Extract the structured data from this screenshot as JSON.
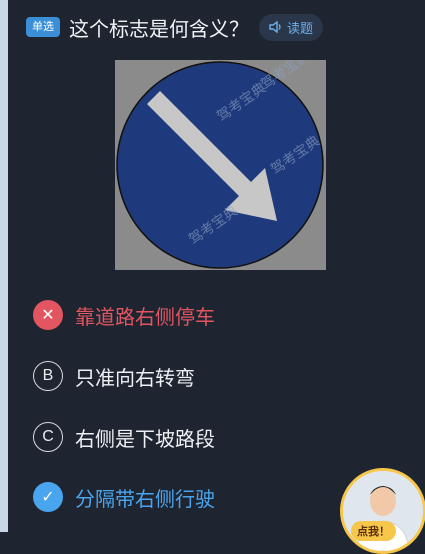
{
  "question": {
    "tag": "单选",
    "text": "这个标志是何含义？",
    "read_button": "读题"
  },
  "sign": {
    "watermark": "驾考宝典",
    "colors": {
      "disk": "#1f3a7c",
      "arrow": "#c7c7c7",
      "background": "#8b8b8b"
    }
  },
  "options": [
    {
      "marker": "✕",
      "text": "靠道路右侧停车",
      "state": "wrong"
    },
    {
      "marker": "B",
      "text": "只准向右转弯",
      "state": "plain"
    },
    {
      "marker": "C",
      "text": "右侧是下坡路段",
      "state": "plain"
    },
    {
      "marker": "✓",
      "text": "分隔带右侧行驶",
      "state": "correct"
    }
  ],
  "assistant": {
    "badge": "点我！"
  },
  "colors": {
    "accent": "#4aa5ef",
    "wrong": "#e25561",
    "tag": "#3a8fd6"
  }
}
